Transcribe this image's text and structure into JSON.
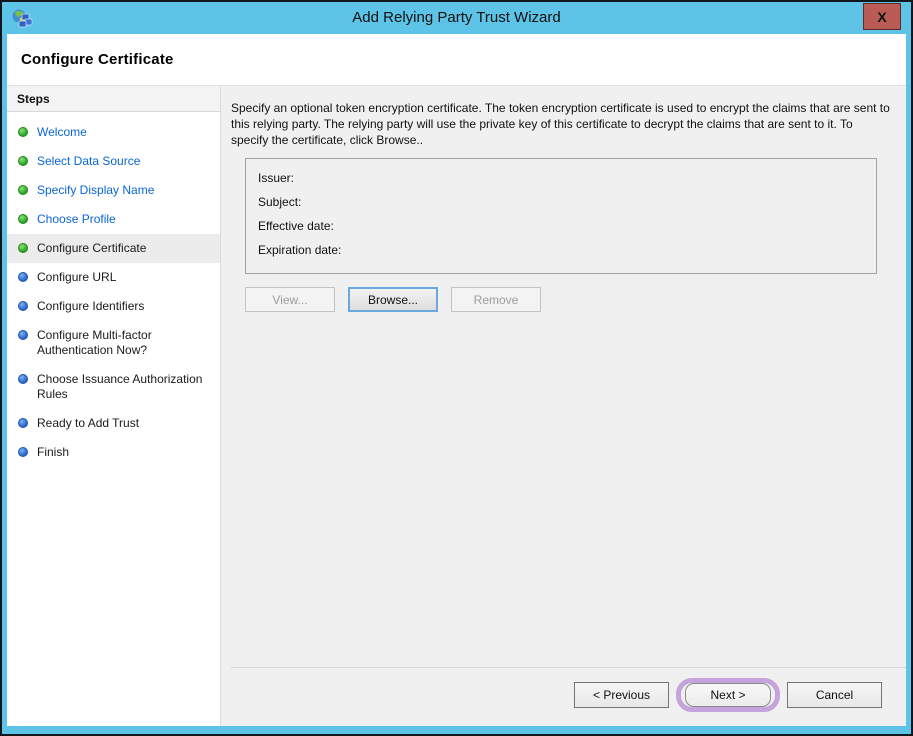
{
  "window": {
    "title": "Add Relying Party Trust Wizard",
    "close_label": "X"
  },
  "colors": {
    "title_bar": "#5ec4e7",
    "link": "#0a66d3",
    "highlight": "#c6a3dc",
    "close_button": "#bb5b55",
    "completed_bullet": "#2fae2f",
    "upcoming_bullet": "#2f6fd0"
  },
  "header": {
    "title": "Configure Certificate"
  },
  "steps": {
    "header": "Steps",
    "items": [
      {
        "label": "Welcome",
        "state": "completed"
      },
      {
        "label": "Select Data Source",
        "state": "completed"
      },
      {
        "label": "Specify Display Name",
        "state": "completed"
      },
      {
        "label": "Choose Profile",
        "state": "completed"
      },
      {
        "label": "Configure Certificate",
        "state": "current"
      },
      {
        "label": "Configure URL",
        "state": "upcoming"
      },
      {
        "label": "Configure Identifiers",
        "state": "upcoming"
      },
      {
        "label": "Configure Multi-factor Authentication Now?",
        "state": "upcoming"
      },
      {
        "label": "Choose Issuance Authorization Rules",
        "state": "upcoming"
      },
      {
        "label": "Ready to Add Trust",
        "state": "upcoming"
      },
      {
        "label": "Finish",
        "state": "upcoming"
      }
    ]
  },
  "content": {
    "description": "Specify an optional token encryption certificate.  The token encryption certificate is used to encrypt the claims that are sent to this relying party.  The relying party will use the private key of this certificate to decrypt the claims that are sent to it.  To specify the certificate, click Browse..",
    "certificate_fields": [
      {
        "label": "Issuer:",
        "value": ""
      },
      {
        "label": "Subject:",
        "value": ""
      },
      {
        "label": "Effective date:",
        "value": ""
      },
      {
        "label": "Expiration date:",
        "value": ""
      }
    ],
    "buttons": {
      "view": "View...",
      "browse": "Browse...",
      "remove": "Remove"
    }
  },
  "footer": {
    "previous": "< Previous",
    "next": "Next >",
    "cancel": "Cancel"
  }
}
